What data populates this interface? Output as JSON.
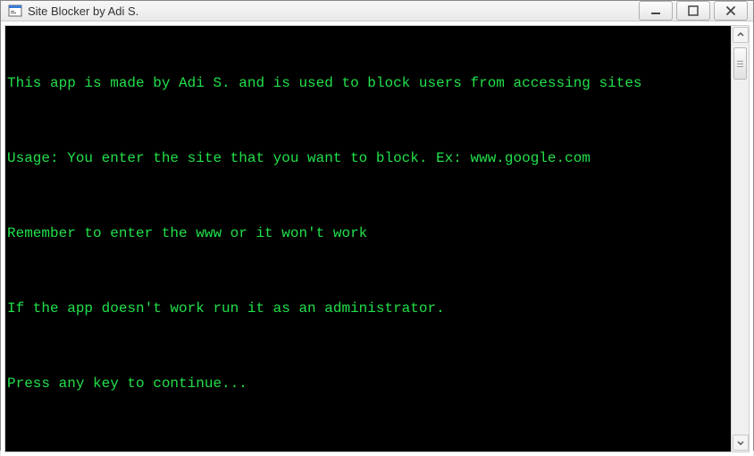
{
  "window": {
    "title": "Site Blocker by Adi S."
  },
  "console": {
    "lines": [
      "This app is made by Adi S. and is used to block users from accessing sites",
      "Usage: You enter the site that you want to block. Ex: www.google.com",
      "Remember to enter the www or it won't work",
      "If the app doesn't work run it as an administrator.",
      "Press any key to continue..."
    ]
  }
}
